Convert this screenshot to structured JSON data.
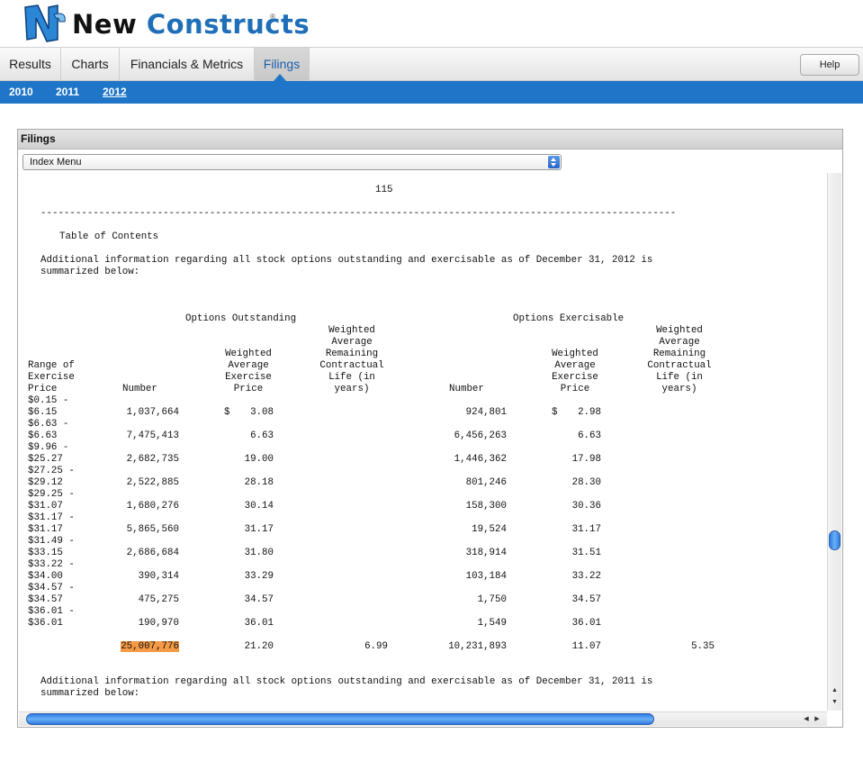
{
  "brand": {
    "name_part1": "New",
    "name_part2": "Constructs",
    "reg": "®",
    "logo_mark_text": "NC"
  },
  "nav": {
    "tabs": [
      {
        "label": "Results"
      },
      {
        "label": "Charts"
      },
      {
        "label": "Financials & Metrics"
      },
      {
        "label": "Filings"
      }
    ],
    "active_tab": "Filings",
    "help_label": "Help"
  },
  "years": {
    "items": [
      "2010",
      "2011",
      "2012"
    ],
    "active": "2012"
  },
  "panel": {
    "title": "Filings",
    "select_value": "Index Menu"
  },
  "document": {
    "page_number": "115",
    "separator": "-------------------------------------------------------------------------------------------------------------",
    "toc": "Table of Contents",
    "intro_2012": "Additional information regarding all stock options outstanding and exercisable as of December 31, 2012 is\nsummarized below:",
    "intro_2011": "Additional information regarding all stock options outstanding and exercisable as of December 31, 2011 is\nsummarized below:",
    "group_outstanding": "Options Outstanding",
    "group_exercisable": "Options Exercisable",
    "col_range": "Range of\nExercise\nPrice",
    "col_number": "Number",
    "col_wavg_price": "Weighted\nAverage\nExercise\nPrice",
    "col_wavg_life": "Weighted\nAverage\nRemaining\nContractual\nLife (in\nyears)",
    "rows": [
      {
        "range1": "$0.15 -",
        "range2": "$6.15",
        "out_num": "1,037,664",
        "out_dollar": "$",
        "out_price": "3.08",
        "ex_num": "924,801",
        "ex_dollar": "$",
        "ex_price": "2.98"
      },
      {
        "range1": "$6.63 -",
        "range2": "$6.63",
        "out_num": "7,475,413",
        "out_dollar": "",
        "out_price": "6.63",
        "ex_num": "6,456,263",
        "ex_dollar": "",
        "ex_price": "6.63"
      },
      {
        "range1": "$9.96 -",
        "range2": "$25.27",
        "out_num": "2,682,735",
        "out_dollar": "",
        "out_price": "19.00",
        "ex_num": "1,446,362",
        "ex_dollar": "",
        "ex_price": "17.98"
      },
      {
        "range1": "$27.25 -",
        "range2": "$29.12",
        "out_num": "2,522,885",
        "out_dollar": "",
        "out_price": "28.18",
        "ex_num": "801,246",
        "ex_dollar": "",
        "ex_price": "28.30"
      },
      {
        "range1": "$29.25 -",
        "range2": "$31.07",
        "out_num": "1,680,276",
        "out_dollar": "",
        "out_price": "30.14",
        "ex_num": "158,300",
        "ex_dollar": "",
        "ex_price": "30.36"
      },
      {
        "range1": "$31.17 -",
        "range2": "$31.17",
        "out_num": "5,865,560",
        "out_dollar": "",
        "out_price": "31.17",
        "ex_num": "19,524",
        "ex_dollar": "",
        "ex_price": "31.17"
      },
      {
        "range1": "$31.49 -",
        "range2": "$33.15",
        "out_num": "2,686,684",
        "out_dollar": "",
        "out_price": "31.80",
        "ex_num": "318,914",
        "ex_dollar": "",
        "ex_price": "31.51"
      },
      {
        "range1": "$33.22 -",
        "range2": "$34.00",
        "out_num": "390,314",
        "out_dollar": "",
        "out_price": "33.29",
        "ex_num": "103,184",
        "ex_dollar": "",
        "ex_price": "33.22"
      },
      {
        "range1": "$34.57 -",
        "range2": "$34.57",
        "out_num": "475,275",
        "out_dollar": "",
        "out_price": "34.57",
        "ex_num": "1,750",
        "ex_dollar": "",
        "ex_price": "34.57"
      },
      {
        "range1": "$36.01 -",
        "range2": "$36.01",
        "out_num": "190,970",
        "out_dollar": "",
        "out_price": "36.01",
        "ex_num": "1,549",
        "ex_dollar": "",
        "ex_price": "36.01"
      }
    ],
    "total": {
      "out_num": "25,007,776",
      "out_price": "21.20",
      "out_life": "6.99",
      "ex_num": "10,231,893",
      "ex_price": "11.07",
      "ex_life": "5.35"
    }
  },
  "colors": {
    "accent": "#1f75c8",
    "highlight": "#f59a45",
    "logo_blue": "#1e6fb8"
  },
  "icons": [
    "select-arrows-icon",
    "scroll-up-icon",
    "scroll-down-icon",
    "scroll-left-icon",
    "scroll-right-icon"
  ]
}
